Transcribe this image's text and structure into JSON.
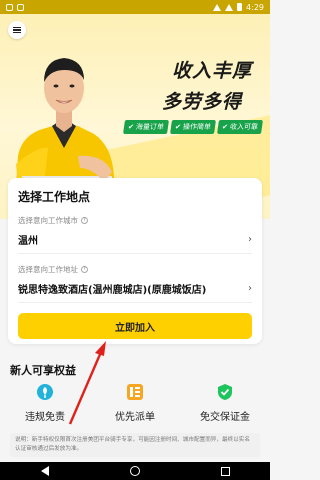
{
  "status_bar": {
    "time": "4:29"
  },
  "hero": {
    "headline_line1": "收入丰厚",
    "headline_line2": "多劳多得",
    "tags": [
      "海量订单",
      "操作简单",
      "收入可靠"
    ]
  },
  "work_location": {
    "title": "选择工作地点",
    "city_label": "选择意向工作城市",
    "city_value": "温州",
    "address_label": "选择意向工作地址",
    "address_value": "锐思特逸致酒店(温州鹿城店)(原鹿城饭店)",
    "join_label": "立即加入"
  },
  "benefits": {
    "title": "新人可享权益",
    "items": [
      {
        "label": "违规免责",
        "icon": "shield-leaf-icon",
        "color": "#21b3d9"
      },
      {
        "label": "优先派单",
        "icon": "priority-list-icon",
        "color": "#f5a623"
      },
      {
        "label": "免交保证金",
        "icon": "check-shield-icon",
        "color": "#1ec45e"
      }
    ]
  },
  "note": "说明：新手特权仅限首次注册美团平台骑手专享，可能因注册时间、城市配置而异，最终以实名认证审核通过后发放为准。",
  "colors": {
    "accent": "#ffd000",
    "tag_green": "#18a34a",
    "arrow": "#e0201b"
  }
}
